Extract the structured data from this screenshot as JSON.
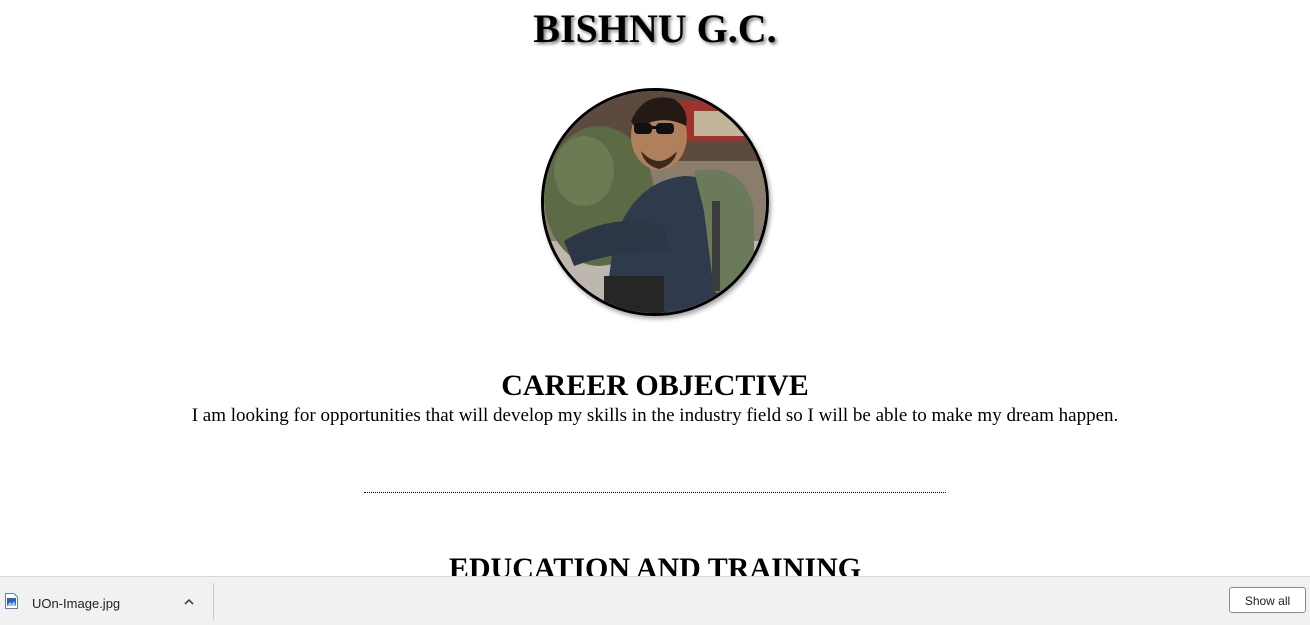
{
  "resume": {
    "name": "BISHNU G.C.",
    "career_objective": {
      "title": "CAREER OBJECTIVE",
      "text": "I am looking for opportunities that will develop my skills in the industry field so I will be able to make my dream happen."
    },
    "education": {
      "title": "EDUCATION AND TRAINING"
    }
  },
  "download_bar": {
    "file_name": "UOn-Image.jpg",
    "file_icon": "image-file-icon",
    "expand_icon": "chevron-up-icon",
    "show_all_label": "Show all"
  }
}
